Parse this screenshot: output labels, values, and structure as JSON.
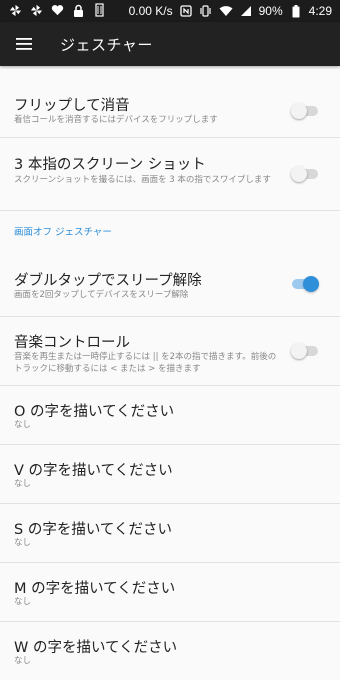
{
  "status_bar": {
    "network_speed": "0.00 K/s",
    "battery": "90%",
    "time": "4:29",
    "left_icons": [
      "pinwheel-icon",
      "pinwheel-icon",
      "heart-icon",
      "lock-icon",
      "battery-saver-icon"
    ],
    "right_icons": [
      "nfc-icon",
      "vibrate-icon",
      "wifi-icon",
      "signal-icon",
      "battery-icon"
    ]
  },
  "app_bar": {
    "title": "ジェスチャー",
    "menu_icon": "hamburger-icon"
  },
  "items": {
    "flip_mute": {
      "title": "フリップして消音",
      "subtitle": "着信コールを消音するにはデバイスをフリップします",
      "enabled": false
    },
    "three_finger": {
      "title": "3 本指のスクリーン ショット",
      "subtitle": "スクリーンショットを撮るには、画面を 3 本の指でスワイプします",
      "enabled": false
    }
  },
  "section": {
    "screen_off_header": "画面オフ ジェスチャー"
  },
  "screen_off_items": {
    "double_tap": {
      "title": "ダブルタップでスリープ解除",
      "subtitle": "画面を2回タップしてデバイスをスリープ解除",
      "enabled": true
    },
    "music_control": {
      "title": "音楽コントロール",
      "subtitle": "音楽を再生または一時停止するには || を2本の指で描きます。前後のトラックに移動するには < または > を描きます",
      "enabled": false
    },
    "draw_o": {
      "title": "O の字を描いてください",
      "subtitle": "なし"
    },
    "draw_v": {
      "title": "V の字を描いてください",
      "subtitle": "なし"
    },
    "draw_s": {
      "title": "S の字を描いてください",
      "subtitle": "なし"
    },
    "draw_m": {
      "title": "M の字を描いてください",
      "subtitle": "なし"
    },
    "draw_w": {
      "title": "W の字を描いてください",
      "subtitle": "なし"
    }
  },
  "colors": {
    "accent": "#2f8fd9",
    "app_bar": "#222222",
    "status_bar": "#1c1c1c",
    "background": "#fafafa"
  }
}
